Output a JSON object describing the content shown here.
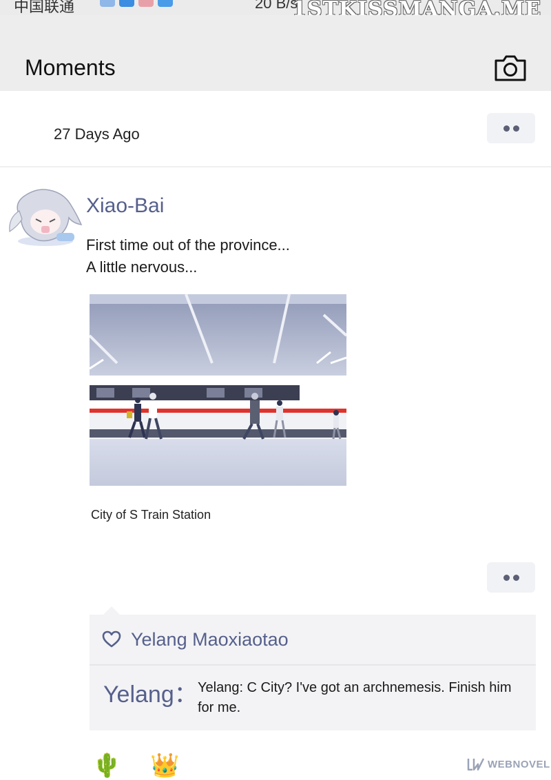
{
  "status_bar": {
    "carrier": "中国联通",
    "speed": "20 B/s",
    "watermark": "1STKISSMANGA.ME"
  },
  "header": {
    "title": "Moments",
    "camera_icon": "camera-icon"
  },
  "date_section": {
    "label": "27 Days Ago",
    "more_icon": "more-dots-icon"
  },
  "post": {
    "author": "Xiao-Bai",
    "text_lines": [
      "First time out of the province...",
      "A little nervous..."
    ],
    "image": "train-station-photo",
    "location": "City of S Train Station",
    "more_icon": "more-dots-icon"
  },
  "interactions": {
    "like_icon": "heart-icon",
    "likes": "Yelang  Maoxiaotao",
    "comments": [
      {
        "author": "Yelang：",
        "text": "Yelang:  C City? I've got an archnemesis. Finish him for me."
      }
    ]
  },
  "bottom": {
    "emojis": [
      "🌵",
      "👑"
    ],
    "brand": "WEBNOVEL"
  },
  "colors": {
    "accent_name": "#56608c",
    "header_bg": "#ededed",
    "comment_bg": "#f3f3f5",
    "train_stripe": "#e0332d"
  }
}
